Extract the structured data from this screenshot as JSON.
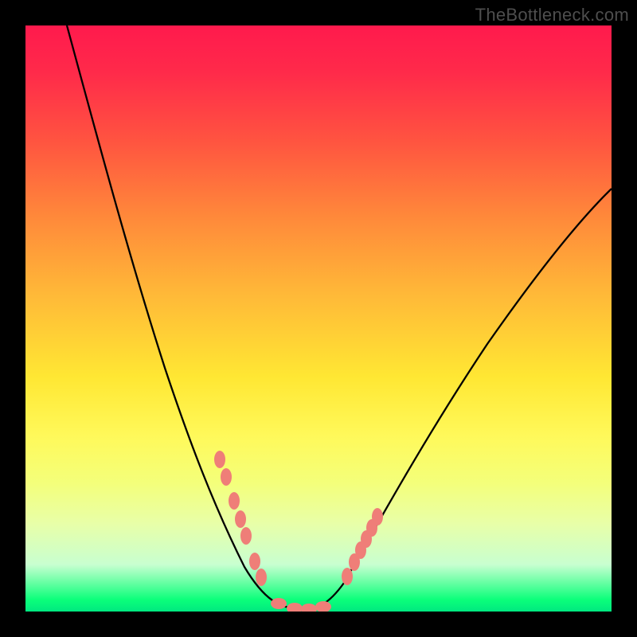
{
  "watermark": "TheBottleneck.com",
  "chart_data": {
    "type": "line",
    "title": "",
    "xlabel": "",
    "ylabel": "",
    "xlim": [
      0,
      100
    ],
    "ylim": [
      0,
      100
    ],
    "grid": false,
    "note": "Stylized bottleneck curve. No numeric axes are shown; values below are normalized 0–100 estimates read from plot geometry (y = 0 at bottom / green, y = 100 at top / red). Curve minimum (~0) sits near x ≈ 43–50.",
    "series": [
      {
        "name": "bottleneck-curve",
        "x": [
          7,
          10,
          14,
          18,
          22,
          26,
          30,
          33,
          36,
          39,
          42,
          45,
          48,
          51,
          54,
          57,
          62,
          68,
          75,
          84,
          94,
          100
        ],
        "y": [
          100,
          90,
          78,
          66,
          55,
          44,
          34,
          26,
          18,
          11,
          5,
          1,
          0,
          1,
          4,
          9,
          17,
          27,
          38,
          49,
          59,
          63
        ]
      }
    ],
    "markers": {
      "name": "highlight-points",
      "note": "Pink capsule markers clustered on both flanks near the valley and along the flat bottom.",
      "points": [
        {
          "x": 33,
          "y": 26
        },
        {
          "x": 34,
          "y": 23
        },
        {
          "x": 36,
          "y": 18
        },
        {
          "x": 37,
          "y": 15
        },
        {
          "x": 38,
          "y": 12
        },
        {
          "x": 40,
          "y": 8
        },
        {
          "x": 41,
          "y": 6
        },
        {
          "x": 44,
          "y": 1
        },
        {
          "x": 46,
          "y": 0
        },
        {
          "x": 48,
          "y": 0
        },
        {
          "x": 50,
          "y": 0.5
        },
        {
          "x": 55,
          "y": 6
        },
        {
          "x": 56,
          "y": 8
        },
        {
          "x": 57,
          "y": 10
        },
        {
          "x": 58,
          "y": 12
        },
        {
          "x": 59,
          "y": 14
        },
        {
          "x": 60,
          "y": 16
        }
      ]
    }
  }
}
